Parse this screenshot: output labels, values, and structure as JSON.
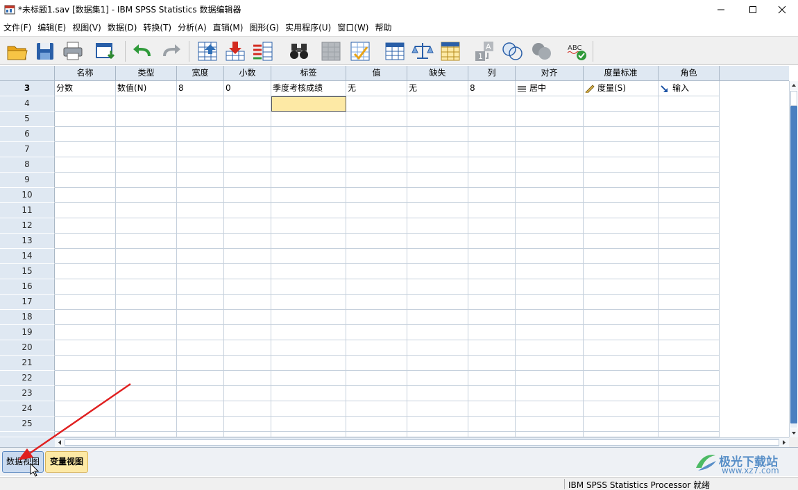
{
  "window": {
    "title": "*未标题1.sav [数据集1] - IBM SPSS Statistics 数据编辑器"
  },
  "menu": [
    {
      "id": "file",
      "label": "文件(F)"
    },
    {
      "id": "edit",
      "label": "编辑(E)"
    },
    {
      "id": "view",
      "label": "视图(V)"
    },
    {
      "id": "data",
      "label": "数据(D)"
    },
    {
      "id": "transform",
      "label": "转换(T)"
    },
    {
      "id": "analyze",
      "label": "分析(A)"
    },
    {
      "id": "direct-marketing",
      "label": "直销(M)"
    },
    {
      "id": "graphs",
      "label": "图形(G)"
    },
    {
      "id": "utilities",
      "label": "实用程序(U)"
    },
    {
      "id": "window",
      "label": "窗口(W)"
    },
    {
      "id": "help",
      "label": "帮助"
    }
  ],
  "toolbar": [
    {
      "name": "open-icon"
    },
    {
      "name": "save-icon"
    },
    {
      "name": "print-icon"
    },
    {
      "name": "dialog-recall-icon"
    },
    {
      "name": "undo-icon"
    },
    {
      "name": "redo-icon"
    },
    {
      "name": "goto-case-icon"
    },
    {
      "name": "goto-variable-icon"
    },
    {
      "name": "variables-icon"
    },
    {
      "name": "find-icon"
    },
    {
      "name": "insert-cases-icon"
    },
    {
      "name": "insert-variable-icon"
    },
    {
      "name": "split-file-icon"
    },
    {
      "name": "weight-cases-icon"
    },
    {
      "name": "select-cases-icon"
    },
    {
      "name": "value-labels-icon"
    },
    {
      "name": "use-sets-icon"
    },
    {
      "name": "show-all-variables-icon"
    },
    {
      "name": "spell-check-icon"
    }
  ],
  "grid": {
    "columns": [
      "名称",
      "类型",
      "宽度",
      "小数",
      "标签",
      "值",
      "缺失",
      "列",
      "对齐",
      "度量标准",
      "角色"
    ],
    "row_numbers": [
      "3",
      "4",
      "5",
      "6",
      "7",
      "8",
      "9",
      "10",
      "11",
      "12",
      "13",
      "14",
      "15",
      "16",
      "17",
      "18",
      "19",
      "20",
      "21",
      "22",
      "23",
      "24",
      "25"
    ],
    "active_row": "3",
    "variable_row": {
      "name": "分数",
      "type": "数值(N)",
      "width": "8",
      "decimals": "0",
      "label": "季度考核成绩",
      "values": "无",
      "missing": "无",
      "columns": "8",
      "align": "居中",
      "measure": "度量(S)",
      "role": "输入"
    }
  },
  "tabs": {
    "data_view": "数据视图",
    "variable_view": "变量视图"
  },
  "status": {
    "text": "IBM SPSS Statistics Processor 就绪"
  },
  "watermark": {
    "text": "极光下载站",
    "url": "www.xz7.com"
  },
  "colors": {
    "header_bg": "#dfe8f2",
    "selected_cell": "#fde9a5",
    "accent_blue": "#4a7fc0",
    "arrow_red": "#e02020"
  }
}
